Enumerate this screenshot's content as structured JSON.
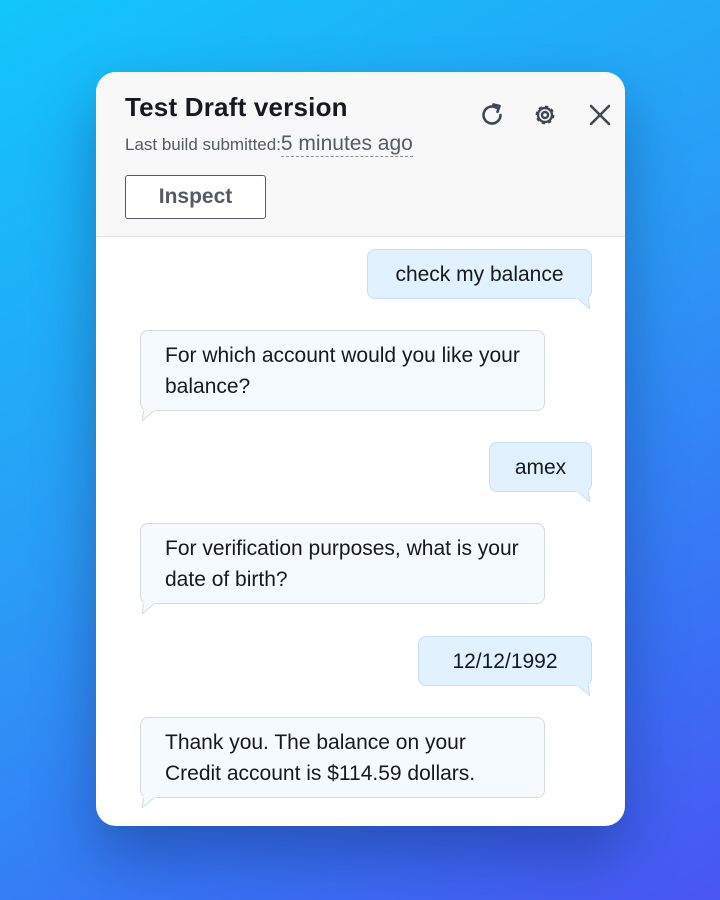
{
  "panel": {
    "title": "Test Draft version",
    "last_build_label": "Last build submitted:",
    "last_build_time": "5 minutes ago",
    "inspect_label": "Inspect",
    "icons": {
      "refresh": "refresh-icon",
      "settings": "gear-icon",
      "close": "close-icon"
    }
  },
  "conversation": [
    {
      "speaker": "user",
      "text": "check my balance"
    },
    {
      "speaker": "bot",
      "text": "For which account would you like your balance?"
    },
    {
      "speaker": "user",
      "text": "amex"
    },
    {
      "speaker": "bot",
      "text": "For verification purposes, what is your date of birth?"
    },
    {
      "speaker": "user",
      "text": "12/12/1992"
    },
    {
      "speaker": "bot",
      "text": "Thank you. The balance on your Credit account is $114.59 dollars."
    }
  ],
  "colors": {
    "user_bubble": "#e1f1fd",
    "bot_bubble": "#f5faff",
    "text": "#16191f",
    "muted": "#545b64"
  }
}
